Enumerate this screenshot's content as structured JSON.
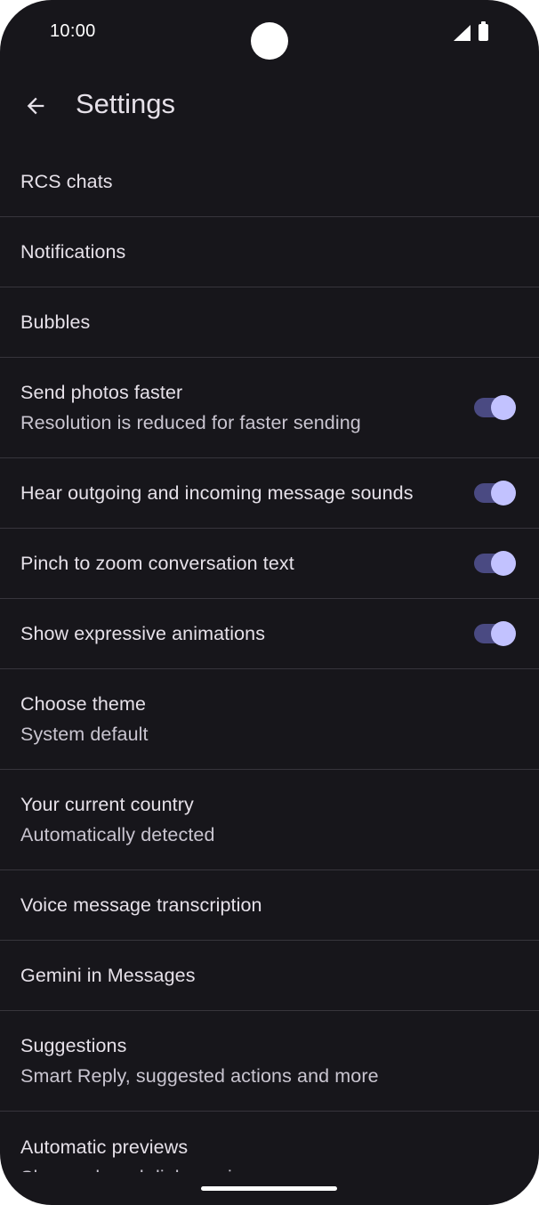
{
  "status_bar": {
    "time": "10:00"
  },
  "header": {
    "title": "Settings"
  },
  "settings": [
    {
      "title": "RCS chats"
    },
    {
      "title": "Notifications"
    },
    {
      "title": "Bubbles"
    },
    {
      "title": "Send photos faster",
      "subtitle": "Resolution is reduced for faster sending",
      "toggle_on": true
    },
    {
      "title": "Hear outgoing and incoming message sounds",
      "toggle_on": true
    },
    {
      "title": "Pinch to zoom conversation text",
      "toggle_on": true
    },
    {
      "title": "Show expressive animations",
      "toggle_on": true
    },
    {
      "title": "Choose theme",
      "subtitle": "System default"
    },
    {
      "title": "Your current country",
      "subtitle": "Automatically detected"
    },
    {
      "title": "Voice message transcription"
    },
    {
      "title": "Gemini in Messages"
    },
    {
      "title": "Suggestions",
      "subtitle": "Smart Reply, suggested actions and more"
    },
    {
      "title": "Automatic previews",
      "subtitle": "Show only web link previews"
    }
  ],
  "colors": {
    "background": "#17161b",
    "text_primary": "#e6e1e9",
    "text_secondary": "#c9c5d0",
    "divider": "#37353c",
    "toggle_track": "#4a4a82",
    "toggle_thumb": "#c2c2ff"
  },
  "icons": {
    "back": "arrow-left-icon",
    "signal": "cell-signal-icon",
    "battery": "battery-icon"
  }
}
